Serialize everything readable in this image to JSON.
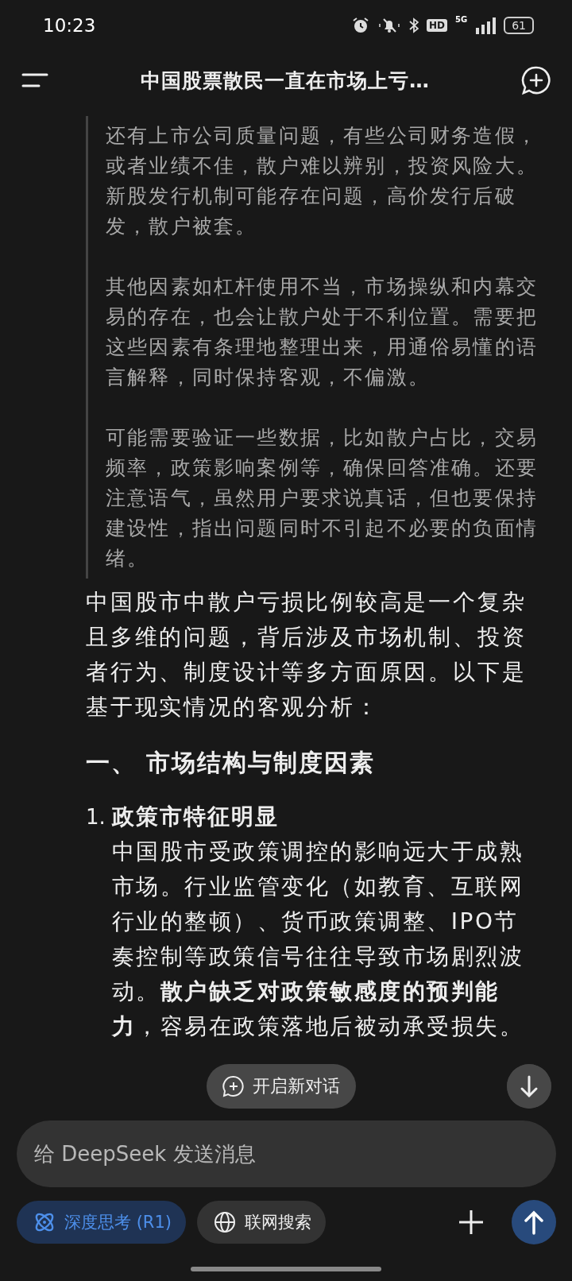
{
  "status_bar": {
    "time": "10:23",
    "hd": "HD",
    "network": "5G",
    "battery": "61"
  },
  "header": {
    "title": "中国股票散民一直在市场上亏…"
  },
  "thinking": {
    "paragraphs": [
      "还有上市公司质量问题，有些公司财务造假，或者业绩不佳，散户难以辨别，投资风险大。新股发行机制可能存在问题，高价发行后破发，散户被套。",
      "其他因素如杠杆使用不当，市场操纵和内幕交易的存在，也会让散户处于不利位置。需要把这些因素有条理地整理出来，用通俗易懂的语言解释，同时保持客观，不偏激。",
      "可能需要验证一些数据，比如散户占比，交易频率，政策影响案例等，确保回答准确。还要注意语气，虽然用户要求说真话，但也要保持建设性，指出问题同时不引起不必要的负面情绪。"
    ]
  },
  "answer": {
    "intro": "中国股市中散户亏损比例较高是一个复杂且多维的问题，背后涉及市场机制、投资者行为、制度设计等多方面原因。以下是基于现实情况的客观分析：",
    "sections": [
      {
        "heading": "一、 市场结构与制度因素",
        "items": [
          {
            "number": "1.",
            "title": "政策市特征明显",
            "text": "中国股市受政策调控的影响远大于成熟市场。行业监管变化（如教育、互联网行业的整顿）、货币政策调整、IPO节奏控制等政策信号往往导致市场剧烈波动。**散户缺乏对政策敏感度的预判能力**，容易在政策落地后被动承受损失。"
          }
        ]
      }
    ]
  },
  "new_chat_button": {
    "label": "开启新对话"
  },
  "composer": {
    "placeholder": "给 DeepSeek 发送消息",
    "toggles": [
      {
        "kind": "deep-think",
        "label": "深度思考 (R1)",
        "selected": true
      },
      {
        "kind": "web-search",
        "label": "联网搜索",
        "selected": false
      }
    ]
  }
}
